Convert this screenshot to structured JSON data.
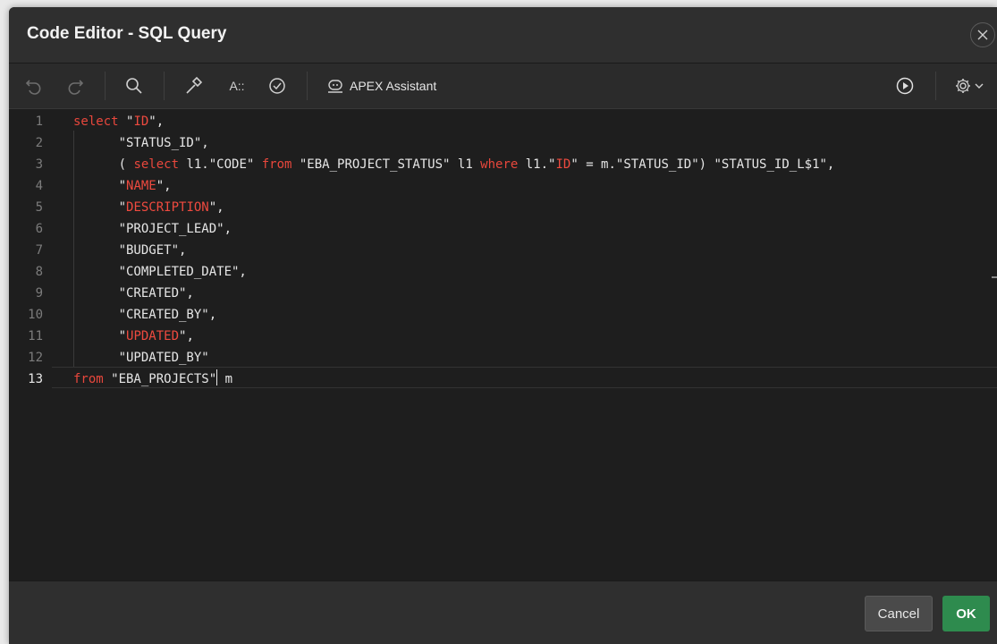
{
  "dialog": {
    "title": "Code Editor - SQL Query"
  },
  "toolbar": {
    "assistant_label": "APEX Assistant",
    "font_size_label": "A::"
  },
  "footer": {
    "cancel_label": "Cancel",
    "ok_label": "OK"
  },
  "editor": {
    "active_line": 13,
    "lines": [
      {
        "n": "1",
        "parts": [
          [
            "kw",
            "select"
          ],
          [
            "t",
            " \""
          ],
          [
            "strhi",
            "ID"
          ],
          [
            "t",
            "\","
          ]
        ]
      },
      {
        "n": "2",
        "parts": [
          [
            "t",
            "      \"STATUS_ID\","
          ]
        ]
      },
      {
        "n": "3",
        "parts": [
          [
            "t",
            "      ( "
          ],
          [
            "kw",
            "select"
          ],
          [
            "t",
            " l1.\"CODE\" "
          ],
          [
            "kw",
            "from"
          ],
          [
            "t",
            " \"EBA_PROJECT_STATUS\" l1 "
          ],
          [
            "kw",
            "where"
          ],
          [
            "t",
            " l1.\""
          ],
          [
            "strhi",
            "ID"
          ],
          [
            "t",
            "\" = m.\"STATUS_ID\") \"STATUS_ID_L$1\","
          ]
        ]
      },
      {
        "n": "4",
        "parts": [
          [
            "t",
            "      \""
          ],
          [
            "strhi",
            "NAME"
          ],
          [
            "t",
            "\","
          ]
        ]
      },
      {
        "n": "5",
        "parts": [
          [
            "t",
            "      \""
          ],
          [
            "strhi",
            "DESCRIPTION"
          ],
          [
            "t",
            "\","
          ]
        ]
      },
      {
        "n": "6",
        "parts": [
          [
            "t",
            "      \"PROJECT_LEAD\","
          ]
        ]
      },
      {
        "n": "7",
        "parts": [
          [
            "t",
            "      \"BUDGET\","
          ]
        ]
      },
      {
        "n": "8",
        "parts": [
          [
            "t",
            "      \"COMPLETED_DATE\","
          ]
        ]
      },
      {
        "n": "9",
        "parts": [
          [
            "t",
            "      \"CREATED\","
          ]
        ]
      },
      {
        "n": "10",
        "parts": [
          [
            "t",
            "      \"CREATED_BY\","
          ]
        ]
      },
      {
        "n": "11",
        "parts": [
          [
            "t",
            "      \""
          ],
          [
            "strhi",
            "UPDATED"
          ],
          [
            "t",
            "\","
          ]
        ]
      },
      {
        "n": "12",
        "parts": [
          [
            "t",
            "      \"UPDATED_BY\""
          ]
        ]
      },
      {
        "n": "13",
        "parts": [
          [
            "kw",
            "from"
          ],
          [
            "t",
            " \"EBA_PROJECTS\""
          ],
          [
            "cursor",
            ""
          ],
          [
            "t",
            " m"
          ]
        ]
      }
    ]
  },
  "colors": {
    "keyword": "#e8473c",
    "ok_button": "#2e8b4e"
  }
}
